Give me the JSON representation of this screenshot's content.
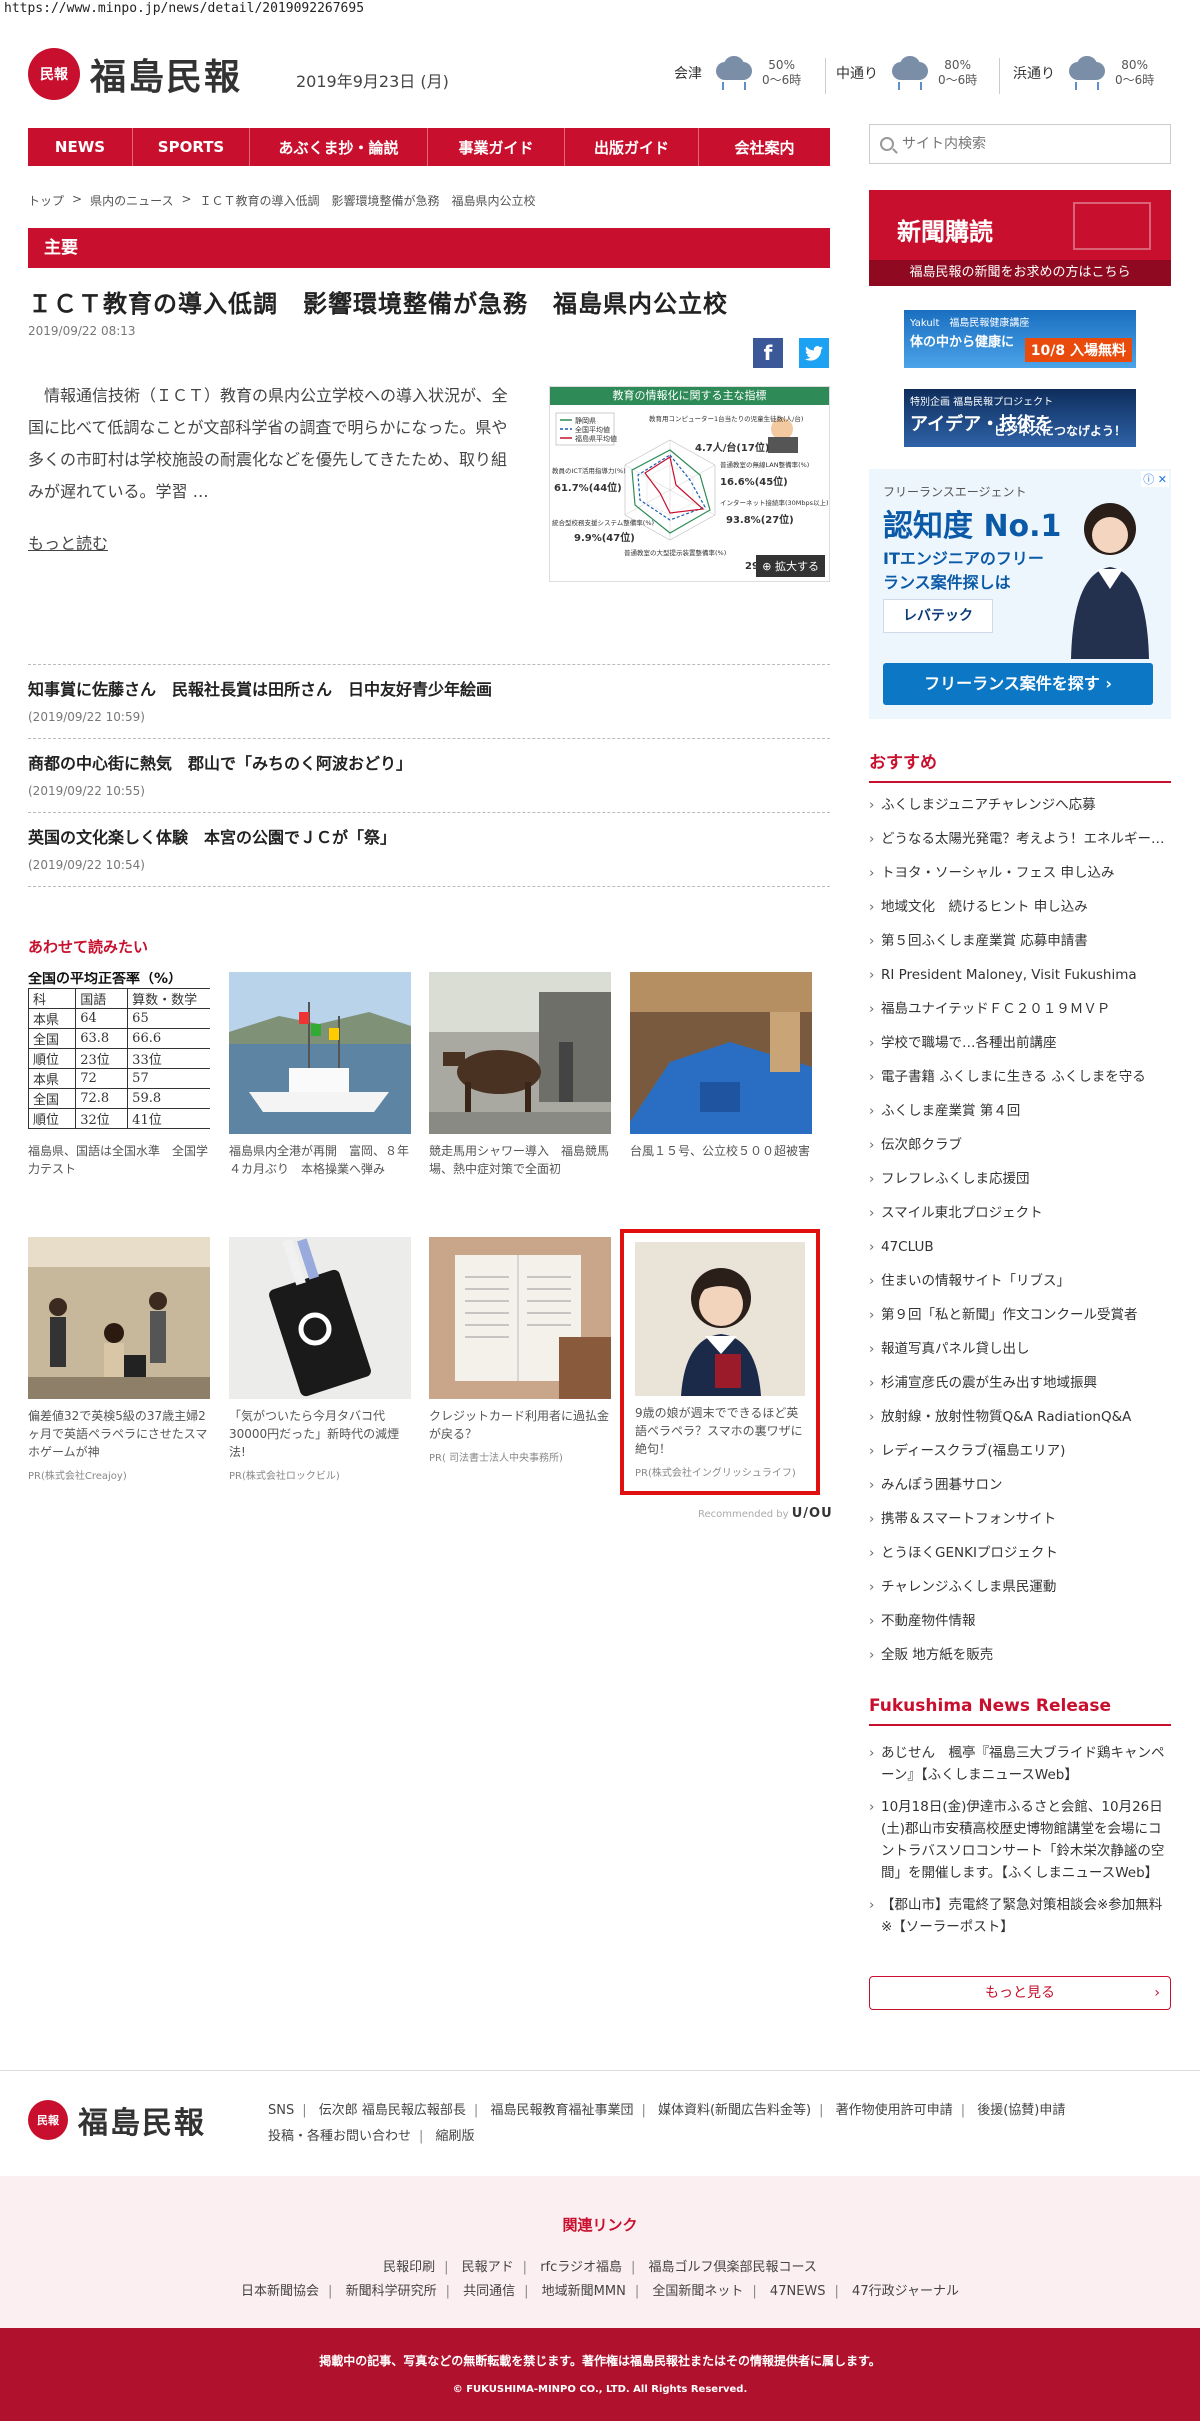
{
  "url": "https://www.minpo.jp/news/detail/2019092267695",
  "header": {
    "logo_mark": "民報",
    "logo_text": "福島民報",
    "date": "2019年9月23日 (月)",
    "weather": [
      {
        "place": "会津",
        "percent": "50%",
        "temp": "0〜6時"
      },
      {
        "place": "中通り",
        "percent": "80%",
        "temp": "0〜6時"
      },
      {
        "place": "浜通り",
        "percent": "80%",
        "temp": "0〜6時"
      }
    ]
  },
  "nav": [
    "NEWS",
    "SPORTS",
    "あぶくま抄・論説",
    "事業ガイド",
    "出版ガイド",
    "会社案内"
  ],
  "search": {
    "placeholder": "サイト内検索"
  },
  "breadcrumb": [
    "トップ",
    ">",
    "県内のニュース",
    ">",
    "ＩＣＴ教育の導入低調　影響環境整備が急務　福島県内公立校"
  ],
  "section": "主要",
  "article": {
    "title": "ＩＣＴ教育の導入低調　影響環境整備が急務　福島県内公立校",
    "date": "2019/09/22 08:13",
    "body": "　情報通信技術（ＩＣＴ）教育の県内公立学校への導入状況が、全国に比べて低調なことが文部科学省の調査で明らかになった。県や多くの市町村は学校施設の耐震化などを優先してきたため、取り組みが遅れている。学習 …",
    "read_more": "もっと読む",
    "figure_title": "教育の情報化に関する主な指標",
    "figure_enlarge": "拡大する",
    "figure_legend": [
      "静岡県",
      "全国平均値",
      "福島県平均値"
    ],
    "figure_labels": [
      {
        "label": "教育用コンピューター1台当たりの児童生徒数(人/台)",
        "value": "4.7人/台(17位)"
      },
      {
        "label": "普通教室の無線LAN整備率(%)",
        "value": "16.6%(45位)"
      },
      {
        "label": "インターネット接続率(30Mbps以上)(%)",
        "value": "93.8%(27位)"
      },
      {
        "label": "普通教室の大型提示装置整備率(%)",
        "value": "29"
      },
      {
        "label": "統合型校務支援システム整備率(%)",
        "value": "9.9%(47位)"
      },
      {
        "label": "教員のICT活用指導力(%)",
        "value": "61.7%(44位)"
      }
    ]
  },
  "news": [
    {
      "title": "知事賞に佐藤さん　民報社長賞は田所さん　日中友好青少年絵画",
      "time": "(2019/09/22 10:59)"
    },
    {
      "title": "商都の中心街に熱気　郡山で「みちのく阿波おどり」",
      "time": "(2019/09/22 10:55)"
    },
    {
      "title": "英国の文化楽しく体験　本宮の公園でＪＣが「祭」",
      "time": "(2019/09/22 10:54)"
    }
  ],
  "also_read": {
    "title": "あわせて読みたい",
    "cards": [
      {
        "caption": "福島県、国語は全国水準　全国学力テスト",
        "pr": ""
      },
      {
        "caption": "福島県内全港が再開　富岡、８年４カ月ぶり　本格操業へ弾み",
        "pr": ""
      },
      {
        "caption": "競走馬用シャワー導入　福島競馬場、熱中症対策で全面初",
        "pr": ""
      },
      {
        "caption": "台風１５号、公立校５００超被害",
        "pr": ""
      },
      {
        "caption": "偏差値32で英検5級の37歳主婦2ヶ月で英語ペラペラにさせたスマホゲームが神",
        "pr": "PR(株式会社Creajoy)"
      },
      {
        "caption": "「気がついたら今月タバコ代30000円だった」新時代の減煙法!",
        "pr": "PR(株式会社ロックビル)"
      },
      {
        "caption": "クレジットカード利用者に過払金が戻る？",
        "pr": "PR( 司法書士法人中央事務所)"
      },
      {
        "caption": "9歳の娘が週末でできるほど英語ペラペラ？スマホの裏ワザに絶句！",
        "pr": "PR(株式会社イングリッシュライフ)"
      }
    ],
    "table_rows": [
      [
        "科",
        "国語",
        "算数・数学"
      ],
      [
        "本県",
        "64",
        "65"
      ],
      [
        "全国",
        "63.8",
        "66.6"
      ],
      [
        "順位",
        "23位",
        "33位"
      ],
      [
        "本県",
        "72",
        "57"
      ],
      [
        "全国",
        "72.8",
        "59.8"
      ],
      [
        "順位",
        "32位",
        "41位"
      ]
    ],
    "table_title": "全国の平均正答率（%）",
    "recommended_prefix": "Recommended by",
    "recommended_brand": "U/OU"
  },
  "sidebar": {
    "subscribe_title": "新聞購読",
    "subscribe_sub": "福島民報の新聞をお求めの方はこちら",
    "ad1_line1": "Yakult　福島民報健康講座",
    "ad1_line2": "体の中から健康に",
    "ad1_tag": "10/8 入場無料",
    "ad2_line1": "特別企画 福島民報プロジェクト",
    "ad2_line2": "アイデア・技術を",
    "ad2_tag": "ビジネスにつなげよう！",
    "ad_big": {
      "t1": "フリーランスエージェント",
      "t2": "認知度 No.1",
      "t3": "ITエンジニアのフリーランス案件探しは",
      "logo": "レバテック",
      "btn": "フリーランス案件を探す ›",
      "close": "ⓘ ✕"
    },
    "recommend_title": "おすすめ",
    "recommend": [
      "ふくしまジュニアチャレンジへ応募",
      "どうなる太陽光発電？考えよう！エネルギー…",
      "トヨタ・ソーシャル・フェス 申し込み",
      "地域文化　続けるヒント 申し込み",
      "第５回ふくしま産業賞 応募申請書",
      "RI President Maloney, Visit Fukushima",
      "福島ユナイテッドＦＣ２０１９ＭＶＰ",
      "学校で職場で…各種出前講座",
      "電子書籍 ふくしまに生きる ふくしまを守る",
      "ふくしま産業賞 第４回",
      "伝次郎クラブ",
      "フレフレふくしま応援団",
      "スマイル東北プロジェクト",
      "47CLUB",
      "住まいの情報サイト「リブス」",
      "第９回「私と新聞」作文コンクール受賞者",
      "報道写真パネル貸し出し",
      "杉浦宣彦氏の震が生み出す地域振興",
      "放射線・放射性物質Q&A RadiationQ&A",
      "レディースクラブ(福島エリア)",
      "みんぽう囲碁サロン",
      "携帯＆スマートフォンサイト",
      "とうほくGENKIプロジェクト",
      "チャレンジふくしま県民運動",
      "不動産物件情報",
      "全販 地方紙を販売"
    ],
    "release_title": "Fukushima News Release",
    "releases": [
      "あじせん　楓亭『福島三大ブライド鶏キャンペーン』【ふくしまニュースWeb】",
      "10月18日(金)伊達市ふるさと会館、10月26日(土)郡山市安積高校歴史博物館講堂を会場にコントラバスソロコンサート「鈴木栄次静謐の空間」を開催します。【ふくしまニュースWeb】",
      "【郡山市】売電終了緊急対策相談会※参加無料※【ソーラーポスト】"
    ],
    "more": "もっと見る"
  },
  "footer": {
    "links_row1": [
      "SNS",
      "伝次郎 福島民報広報部長",
      "福島民報教育福祉事業団",
      "媒体資料(新聞広告料金等)",
      "著作物使用許可申請",
      "後援(協賛)申請"
    ],
    "links_row2": [
      "投稿・各種お問い合わせ",
      "縮刷版"
    ],
    "related_title": "関連リンク",
    "related_row1": [
      "民報印刷",
      "民報アド",
      "rfcラジオ福島",
      "福島ゴルフ倶楽部民報コース"
    ],
    "related_row2": [
      "日本新聞協会",
      "新聞科学研究所",
      "共同通信",
      "地域新聞MMN",
      "全国新聞ネット",
      "47NEWS",
      "47行政ジャーナル"
    ],
    "notice": "掲載中の記事、写真などの無断転載を禁じます。著作権は福島民報社またはその情報提供者に属します。",
    "copyright": "© FUKUSHIMA-MINPO CO., LTD. All Rights Reserved."
  },
  "colors": {
    "brand": "#c8102e",
    "highlight": "#e01010"
  }
}
